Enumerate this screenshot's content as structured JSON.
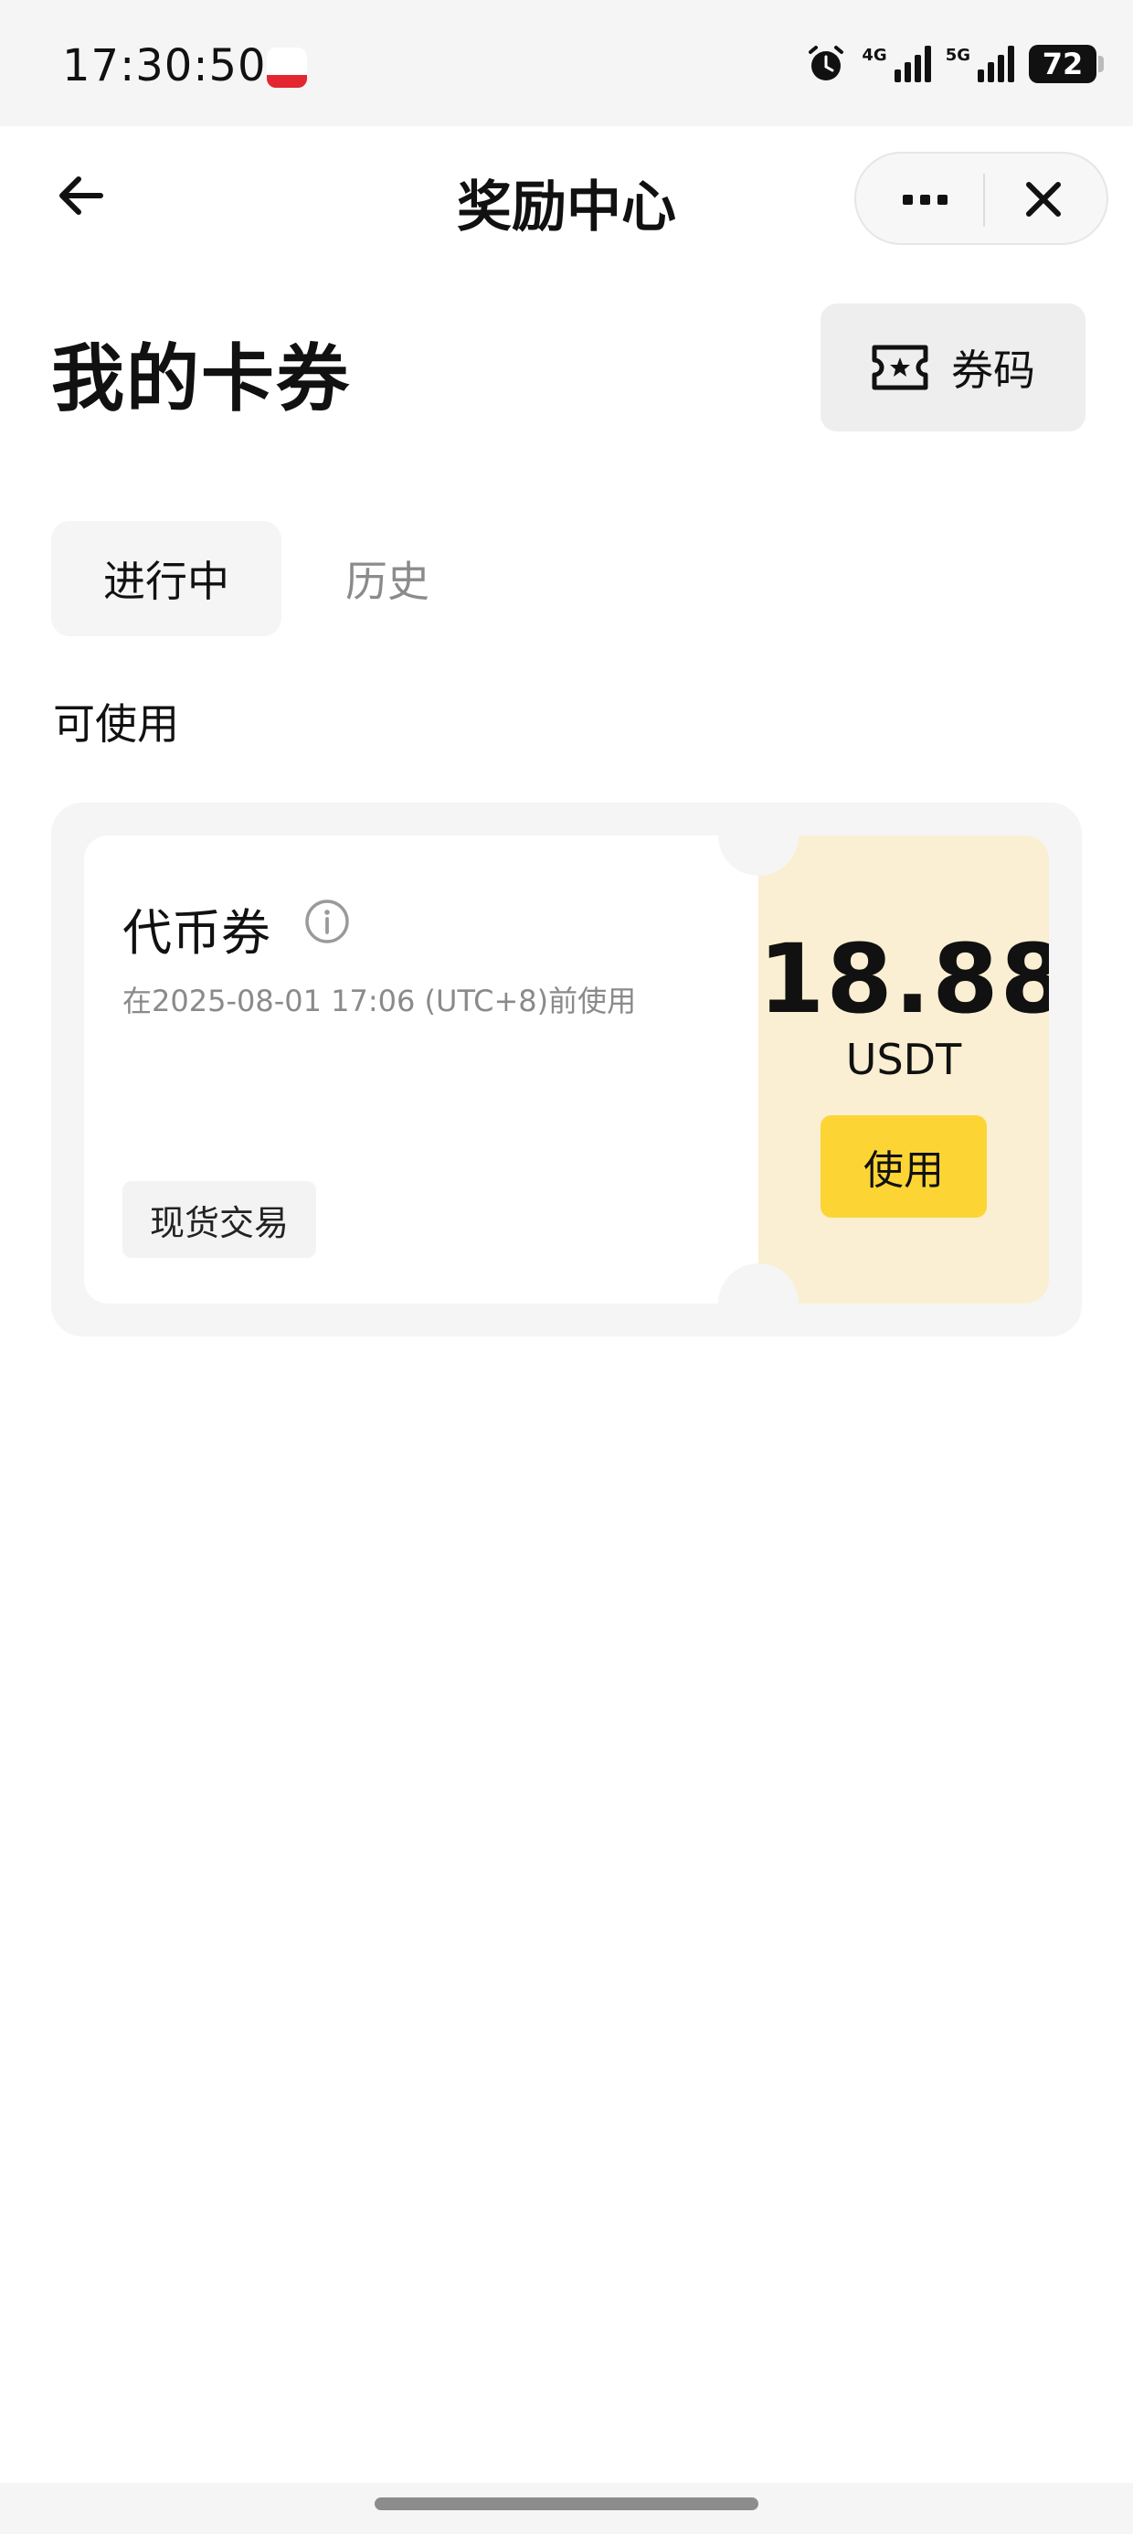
{
  "status_bar": {
    "time": "17:30:50",
    "network_1": "4G",
    "network_2": "5G",
    "battery": "72",
    "icons": [
      "app-notification-icon",
      "alarm-icon",
      "signal-icon",
      "battery-icon"
    ]
  },
  "navbar": {
    "title": "奖励中心",
    "icons": [
      "back-arrow-icon",
      "more-icon",
      "close-icon"
    ]
  },
  "header": {
    "title": "我的卡券",
    "coupon_code_label": "券码",
    "coupon_code_icon": "ticket-star-icon"
  },
  "tabs": [
    {
      "label": "进行中",
      "active": true
    },
    {
      "label": "历史",
      "active": false
    }
  ],
  "section_label": "可使用",
  "vouchers": [
    {
      "name": "代币券",
      "expiry": "在2025-08-01 17:06 (UTC+8)前使用",
      "tag": "现货交易",
      "amount": "18.88",
      "unit": "USDT",
      "use_label": "使用",
      "icon": "info-icon"
    }
  ],
  "colors": {
    "accent": "#fcd535",
    "voucher_panel": "#faefd2",
    "muted_text": "#8a8a8a",
    "background_gray": "#f5f5f5"
  }
}
